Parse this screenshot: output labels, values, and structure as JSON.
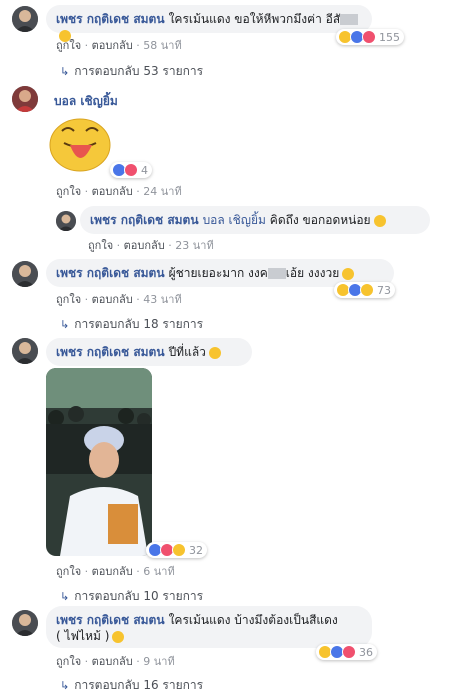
{
  "c1": {
    "name": "เพชร กฤติเดช สมตน",
    "text": "ใครเม้นแดง ขอให้หีพวกมึงฅ่า อีสั",
    "like": "ถูกใจ",
    "reply": "ตอบกลับ",
    "time": "58 นาที",
    "count": "155"
  },
  "c1_replies": "การตอบกลับ 53 รายการ",
  "c2": {
    "name": "บอล เชิญยิ้ม",
    "like": "ถูกใจ",
    "reply": "ตอบกลับ",
    "time": "24 นาที",
    "count": "4"
  },
  "c2r": {
    "name": "เพชร กฤติเดช สมตน",
    "mention": "บอล เชิญยิ้ม",
    "text": "คิดถึง ขอกอดหน่อย",
    "like": "ถูกใจ",
    "reply": "ตอบกลับ",
    "time": "23 นาที"
  },
  "c3": {
    "name": "เพชร กฤติเดช สมตน",
    "text_a": "ผู้ชายเยอะมาก งงค",
    "text_b": "เอ้ย งงงวย",
    "like": "ถูกใจ",
    "reply": "ตอบกลับ",
    "time": "43 นาที",
    "count": "73"
  },
  "c3_replies": "การตอบกลับ 18 รายการ",
  "c4": {
    "name": "เพชร กฤติเดช สมตน",
    "text": "ปีที่แล้ว",
    "like": "ถูกใจ",
    "reply": "ตอบกลับ",
    "time": "6 นาที",
    "count": "32"
  },
  "c4_replies": "การตอบกลับ 10 รายการ",
  "c5": {
    "name": "เพชร กฤติเดช สมตน",
    "text_1": "ใครเม้นแดง บ้างมึงต้องเป็นสีแดง",
    "text_2": "( ไฟไหม้ )",
    "like": "ถูกใจ",
    "reply": "ตอบกลับ",
    "time": "9 นาที",
    "count": "36"
  },
  "c5_replies": "การตอบกลับ 16 รายการ",
  "colors": {
    "name": "#385898",
    "bubble": "#f2f3f5",
    "meta": "#90949c",
    "haha": "#f7c32e",
    "like": "#4a76e8",
    "love": "#f0506e"
  },
  "icons": {
    "reply_arrow": "reply-arrow-icon",
    "reactions": [
      "haha",
      "like",
      "love",
      "wow"
    ]
  }
}
